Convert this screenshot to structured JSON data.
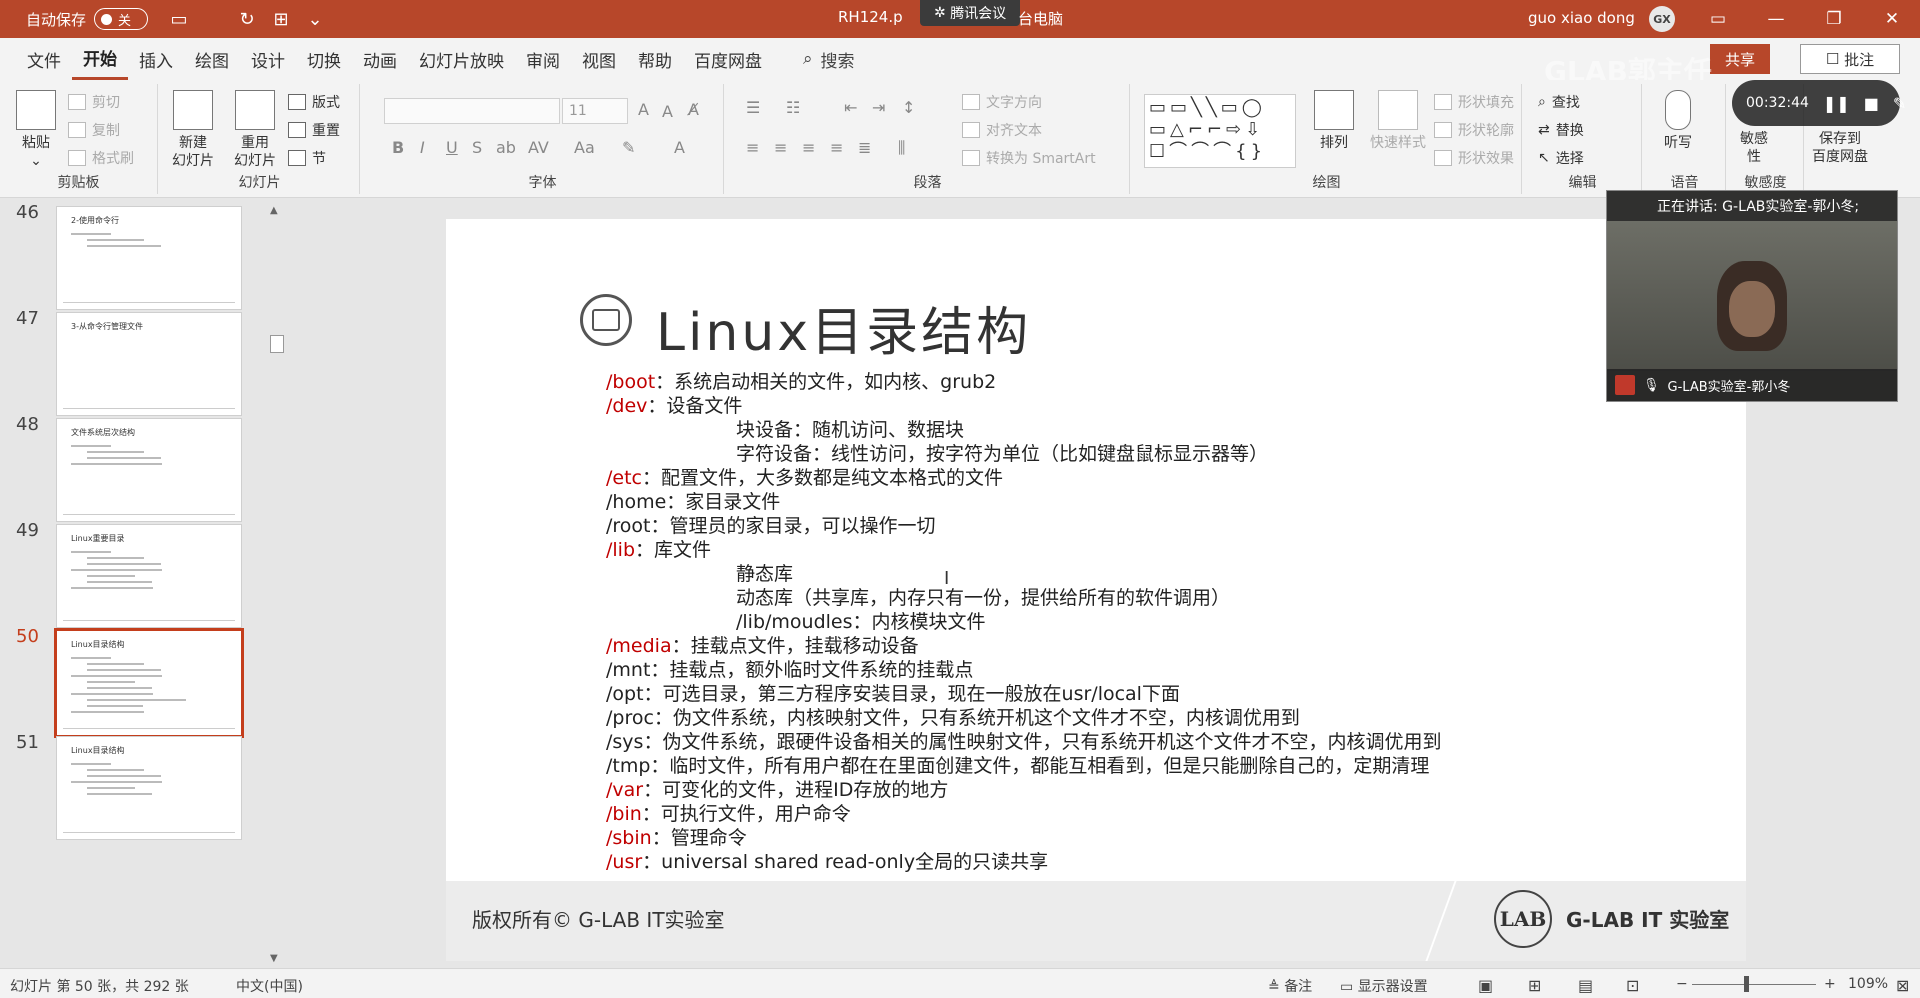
{
  "titlebar": {
    "autosave_label": "自动保存",
    "autosave_state": "关",
    "doc_title": "RH124.p",
    "meeting_popup": "腾讯会议",
    "doc_title_rest": "台电脑",
    "user_name": "guo xiao dong",
    "user_initials": "GX"
  },
  "tabs": [
    "文件",
    "开始",
    "插入",
    "绘图",
    "设计",
    "切换",
    "动画",
    "幻灯片放映",
    "审阅",
    "视图",
    "帮助",
    "百度网盘"
  ],
  "active_tab": "开始",
  "search_label": "搜索",
  "share_label": "共享",
  "comment_label": "批注",
  "ribbon": {
    "clipboard": {
      "label": "剪贴板",
      "paste": "粘贴",
      "cut": "剪切",
      "copy": "复制",
      "format_painter": "格式刷"
    },
    "slides": {
      "label": "幻灯片",
      "new_slide": "新建\n幻灯片",
      "reuse_slide": "重用\n幻灯片",
      "layout": "版式",
      "reset": "重置",
      "section": "节"
    },
    "font": {
      "label": "字体",
      "size": "11"
    },
    "paragraph": {
      "label": "段落",
      "text_direction": "文字方向",
      "align_text": "对齐文本",
      "smartart": "转换为 SmartArt"
    },
    "drawing": {
      "label": "绘图",
      "arrange": "排列",
      "quick_styles": "快速样式",
      "shape_fill": "形状填充",
      "shape_outline": "形状轮廓",
      "shape_effects": "形状效果"
    },
    "editing": {
      "label": "编辑",
      "find": "查找",
      "replace": "替换",
      "select": "选择"
    },
    "voice": {
      "label": "语音",
      "dictate": "听写"
    },
    "sensitivity": {
      "label": "敏感度",
      "text": "敏感\n性"
    },
    "save_baidu": {
      "text": "保存到\n百度网盘"
    }
  },
  "thumbnails": [
    {
      "num": "46",
      "title": "2-使用命令行"
    },
    {
      "num": "47",
      "title": "3-从命令行管理文件"
    },
    {
      "num": "48",
      "title": "文件系统层次结构"
    },
    {
      "num": "49",
      "title": "Linux重要目录"
    },
    {
      "num": "50",
      "title": "Linux目录结构",
      "active": true
    },
    {
      "num": "51",
      "title": "Linux目录结构"
    }
  ],
  "slide": {
    "title": "Linux目录结构",
    "lines": [
      {
        "key": "/boot",
        "text": "：系统启动相关的文件，如内核、grub2"
      },
      {
        "key": "/dev",
        "text": "：设备文件"
      },
      {
        "key": "",
        "text": "块设备：随机访问、数据块",
        "indent": true
      },
      {
        "key": "",
        "text": "字符设备：线性访问，按字符为单位（比如键盘鼠标显示器等）",
        "indent": true
      },
      {
        "key": "/etc",
        "text": "：配置文件，大多数都是纯文本格式的文件"
      },
      {
        "key": "",
        "text": "/home：家目录文件"
      },
      {
        "key": "",
        "text": "/root：管理员的家目录，可以操作一切"
      },
      {
        "key": "/lib",
        "text": "：库文件"
      },
      {
        "key": "",
        "text": "静态库",
        "indent": true
      },
      {
        "key": "",
        "text": "动态库（共享库，内存只有一份，提供给所有的软件调用）",
        "indent": true
      },
      {
        "key": "",
        "text": "/lib/moudles：内核模块文件",
        "indent": true
      },
      {
        "key": "/media",
        "text": "：挂载点文件，挂载移动设备"
      },
      {
        "key": "",
        "text": "/mnt：挂载点，额外临时文件系统的挂载点"
      },
      {
        "key": "",
        "text": "/opt：可选目录，第三方程序安装目录，现在一般放在usr/local下面"
      },
      {
        "key": "",
        "text": "/proc：伪文件系统，内核映射文件，只有系统开机这个文件才不空，内核调优用到"
      },
      {
        "key": "",
        "text": "/sys：伪文件系统，跟硬件设备相关的属性映射文件，只有系统开机这个文件才不空，内核调优用到"
      },
      {
        "key": "",
        "text": "/tmp：临时文件，所有用户都在在里面创建文件，都能互相看到，但是只能删除自己的，定期清理"
      },
      {
        "key": "/var",
        "text": "：可变化的文件，进程ID存放的地方"
      },
      {
        "key": "/bin",
        "text": "：可执行文件，用户命令"
      },
      {
        "key": "/sbin",
        "text": "：管理命令"
      },
      {
        "key": "/usr",
        "text": "：universal shared read-only全局的只读共享"
      }
    ],
    "copyright": "版权所有© G-LAB IT实验室",
    "logo_text": "LAB",
    "org_name": "G-LAB IT 实验室"
  },
  "video": {
    "speaking": "正在讲话: G-LAB实验室-郭小冬;",
    "participant": "G-LAB实验室-郭小冬"
  },
  "recording": {
    "time": "00:32:44"
  },
  "watermark": "GLAB郭主任",
  "statusbar": {
    "slide_info": "幻灯片 第 50 张，共 292 张",
    "language": "中文(中国)",
    "notes": "备注",
    "display_settings": "显示器设置",
    "zoom": "109%"
  },
  "colors": {
    "accent": "#b7472a",
    "keyword_red": "#c00000",
    "active_thumb": "#c43e1c"
  }
}
